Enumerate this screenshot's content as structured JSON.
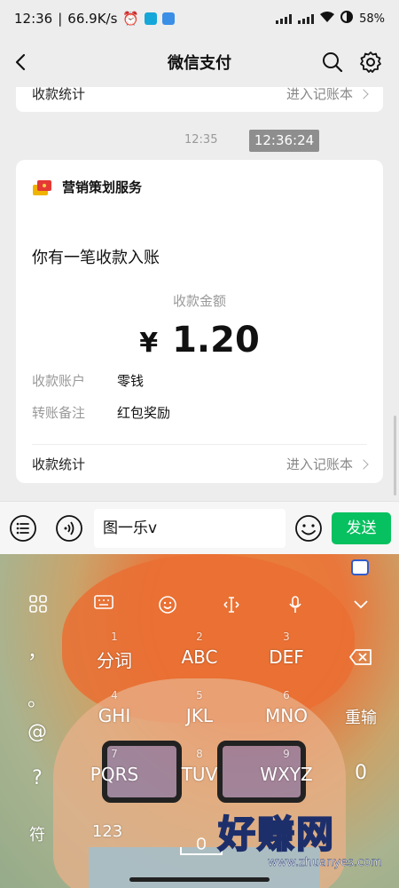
{
  "status_bar": {
    "time": "12:36",
    "network_speed": "66.9K/s",
    "battery": "58%"
  },
  "nav": {
    "title": "微信支付"
  },
  "chat": {
    "top_card": {
      "label": "收款统计",
      "link": "进入记账本"
    },
    "time_small": "12:35",
    "time_badge": "12:36:24",
    "payment_card": {
      "service_name": "营销策划服务",
      "message": "你有一笔收款入账",
      "amount_label": "收款金额",
      "currency": "¥",
      "amount": "1.20",
      "rows": [
        {
          "key": "收款账户",
          "value": "零钱"
        },
        {
          "key": "转账备注",
          "value": "红包奖励"
        }
      ],
      "footer_label": "收款统计",
      "footer_link": "进入记账本"
    }
  },
  "input_bar": {
    "text": "图一乐v",
    "send_label": "发送"
  },
  "keyboard": {
    "rows": [
      [
        {
          "num": "1",
          "label": "分词"
        },
        {
          "num": "2",
          "label": "ABC"
        },
        {
          "num": "3",
          "label": "DEF"
        }
      ],
      [
        {
          "num": "4",
          "label": "GHI"
        },
        {
          "num": "5",
          "label": "JKL"
        },
        {
          "num": "6",
          "label": "MNO"
        }
      ],
      [
        {
          "num": "7",
          "label": "PQRS"
        },
        {
          "num": "8",
          "label": "TUV"
        },
        {
          "num": "9",
          "label": "WXYZ"
        }
      ]
    ],
    "side_keys": [
      "，",
      "。",
      "@",
      "?"
    ],
    "relearn_key": "重输",
    "zero_key": "0",
    "symbol_key": "符",
    "numeric_key": "123"
  },
  "watermark": {
    "text": "好赚网",
    "url": "www.zhuanyes.com"
  }
}
